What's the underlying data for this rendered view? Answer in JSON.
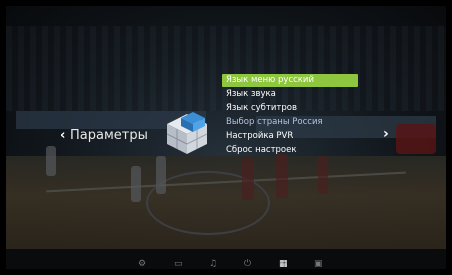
{
  "menu": {
    "section_title": "Параметры",
    "prev_arrow": "‹",
    "next_arrow": "›",
    "items": [
      {
        "label": "Язык меню русский",
        "state": "selected"
      },
      {
        "label": "Язык звука",
        "state": "normal"
      },
      {
        "label": "Язык субтитров",
        "state": "normal"
      },
      {
        "label": "Выбор страны Россия",
        "state": "dim"
      },
      {
        "label": "Настройка PVR",
        "state": "normal"
      },
      {
        "label": "Сброс настроек",
        "state": "normal"
      }
    ]
  },
  "bottom_nav": {
    "icons": [
      {
        "name": "settings-gear-icon",
        "glyph": "⚙"
      },
      {
        "name": "monitor-icon",
        "glyph": "▭"
      },
      {
        "name": "music-note-icon",
        "glyph": "♫"
      },
      {
        "name": "power-icon",
        "glyph": "⏻"
      },
      {
        "name": "grid-icon",
        "glyph": "▦"
      },
      {
        "name": "lock-icon",
        "glyph": "▣"
      }
    ],
    "active_index": 4
  },
  "colors": {
    "highlight": "#8ec63f",
    "icon_blue": "#3b8fd6"
  }
}
